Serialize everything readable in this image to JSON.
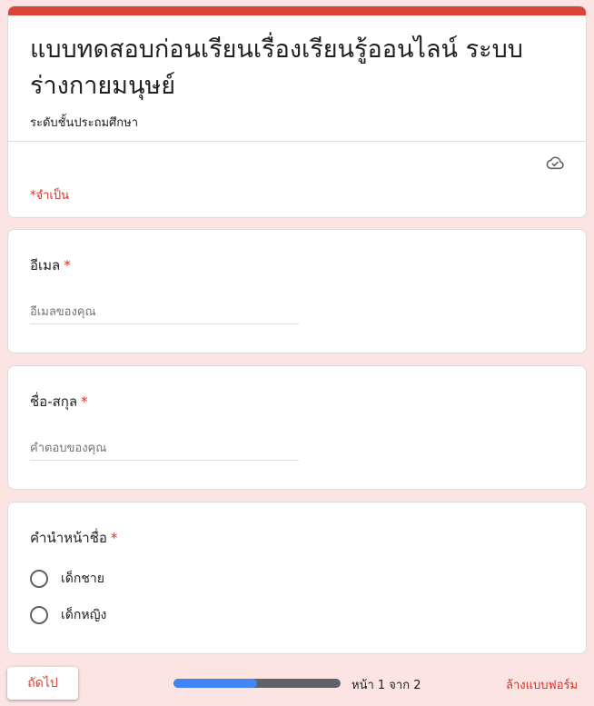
{
  "form": {
    "title": "แบบทดสอบก่อนเรียนเรื่องเรียนรู้ออนไลน์ ระบบร่างกายมนุษย์",
    "description": "ระดับชั้นประถมศึกษา",
    "required_note": "*จำเป็น",
    "accent_color": "#db4437"
  },
  "questions": [
    {
      "title": "อีเมล",
      "required_mark": "*",
      "placeholder": "อีเมลของคุณ",
      "value": ""
    },
    {
      "title": "ชื่อ-สกุล",
      "required_mark": "*",
      "placeholder": "คำตอบของคุณ",
      "value": ""
    },
    {
      "title": "คำนำหน้าชื่อ",
      "required_mark": "*",
      "options": [
        "เด็กชาย",
        "เด็กหญิง"
      ]
    }
  ],
  "footer": {
    "next_label": "ถัดไป",
    "progress": 0.5,
    "page_indicator": "หน้า 1 จาก 2",
    "clear_label": "ล้างแบบฟอร์ม"
  },
  "icons": {
    "cloud": "cloud-check-icon"
  }
}
